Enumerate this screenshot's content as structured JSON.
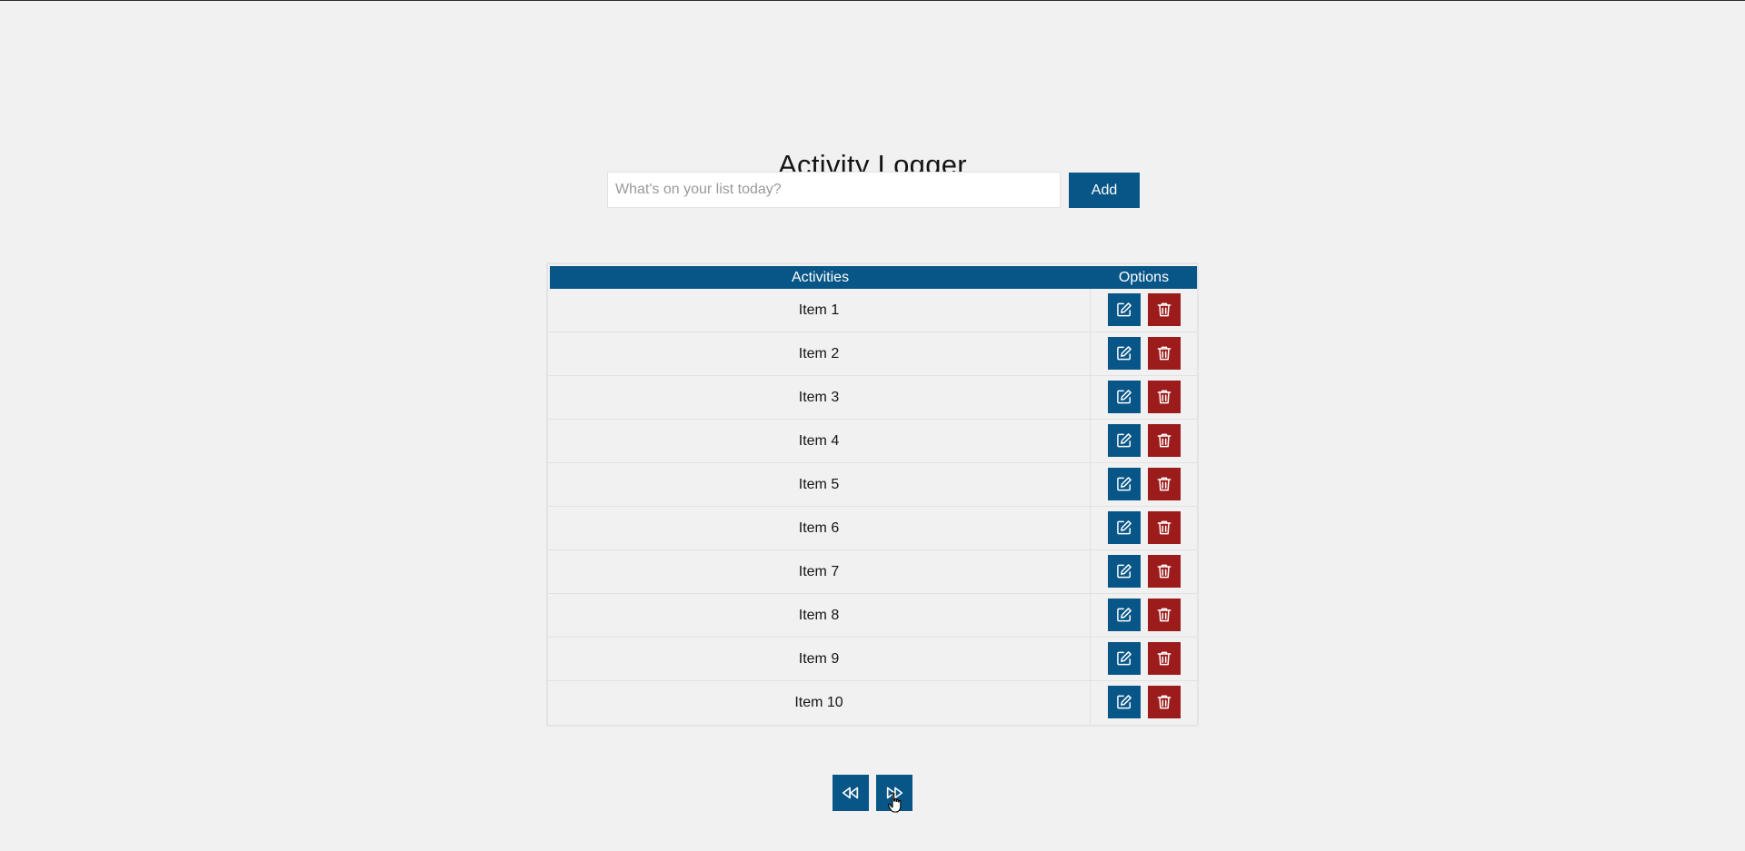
{
  "app": {
    "title": "Activity Logger"
  },
  "add_form": {
    "input_value": "",
    "input_placeholder": "What's on your list today?",
    "add_label": "Add"
  },
  "table": {
    "headers": {
      "activities": "Activities",
      "options": "Options"
    },
    "rows": [
      {
        "activity": "Item 1"
      },
      {
        "activity": "Item 2"
      },
      {
        "activity": "Item 3"
      },
      {
        "activity": "Item 4"
      },
      {
        "activity": "Item 5"
      },
      {
        "activity": "Item 6"
      },
      {
        "activity": "Item 7"
      },
      {
        "activity": "Item 8"
      },
      {
        "activity": "Item 9"
      },
      {
        "activity": "Item 10"
      }
    ]
  },
  "icons": {
    "edit": "edit-icon",
    "delete": "trash-icon",
    "prev": "rewind-icon",
    "next": "fast-forward-icon"
  },
  "colors": {
    "primary": "#085687",
    "danger": "#9c1c1c",
    "background": "#f2f1f1"
  }
}
